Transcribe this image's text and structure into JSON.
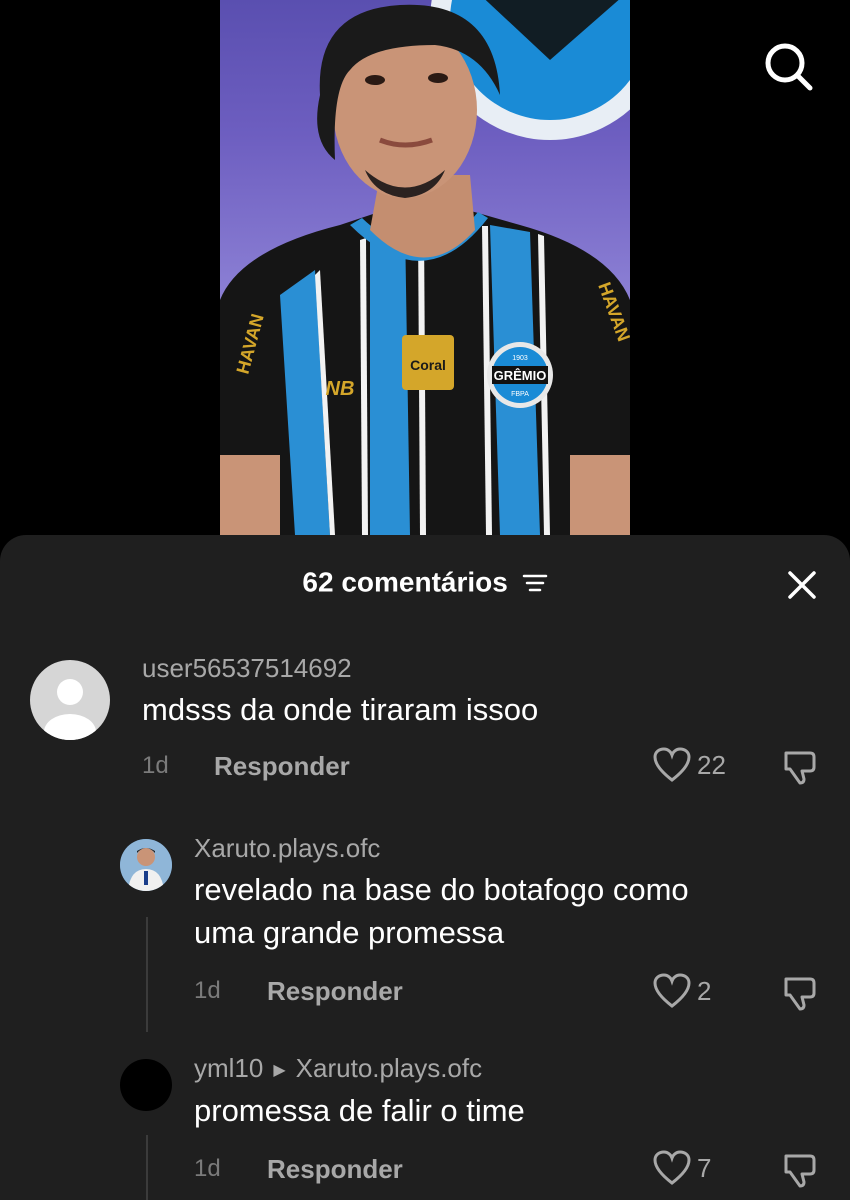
{
  "header": {
    "count_label": "62 comentários"
  },
  "icons": {
    "search": "search-icon",
    "filter": "filter-icon",
    "close": "close-icon",
    "like": "heart-icon",
    "dislike": "dislike-icon"
  },
  "video": {
    "jersey_sponsor_left": "HAVAN",
    "jersey_sponsor_right": "HAVAN",
    "jersey_chest_sponsor": "Coral",
    "jersey_badge": "GRÊMIO",
    "jersey_badge_year": "1903",
    "jersey_badge_sub": "FBPA"
  },
  "comments": [
    {
      "username": "user56537514692",
      "text": "mdsss da onde tiraram issoo",
      "time": "1d",
      "reply_label": "Responder",
      "likes": "22"
    },
    {
      "username": "Xaruto.plays.ofc",
      "text_line1": "revelado na base do botafogo como",
      "text_line2": "uma grande promessa",
      "time": "1d",
      "reply_label": "Responder",
      "likes": "2"
    },
    {
      "username": "yml10",
      "reply_to": "Xaruto.plays.ofc",
      "text": "promessa de falir o time",
      "time": "1d",
      "reply_label": "Responder",
      "likes": "7"
    }
  ]
}
